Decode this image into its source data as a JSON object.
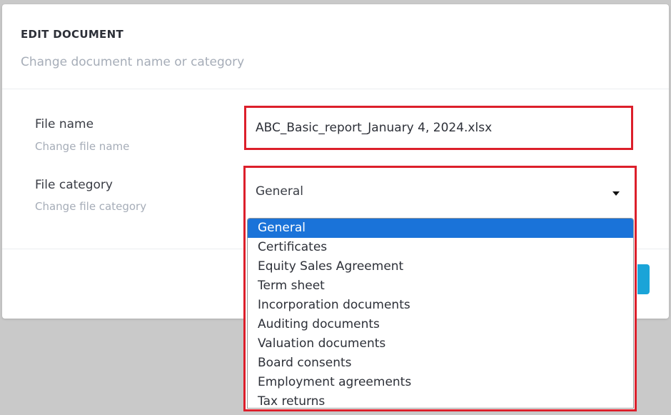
{
  "modal": {
    "title": "EDIT DOCUMENT",
    "subtitle": "Change document name or category"
  },
  "fields": {
    "file_name": {
      "label": "File name",
      "hint": "Change file name",
      "value": "ABC_Basic_report_January 4, 2024.xlsx"
    },
    "file_category": {
      "label": "File category",
      "hint": "Change file category",
      "selected": "General",
      "options": [
        "General",
        "Certificates",
        "Equity Sales Agreement",
        "Term sheet",
        "Incorporation documents",
        "Auditing documents",
        "Valuation documents",
        "Board consents",
        "Employment agreements",
        "Tax returns"
      ]
    }
  },
  "colors": {
    "highlight_border": "#dc1f2b",
    "selected_option": "#1a73d9",
    "primary_button": "#1aa4d8"
  },
  "icons": {
    "dropdown": "caret-down-icon"
  }
}
